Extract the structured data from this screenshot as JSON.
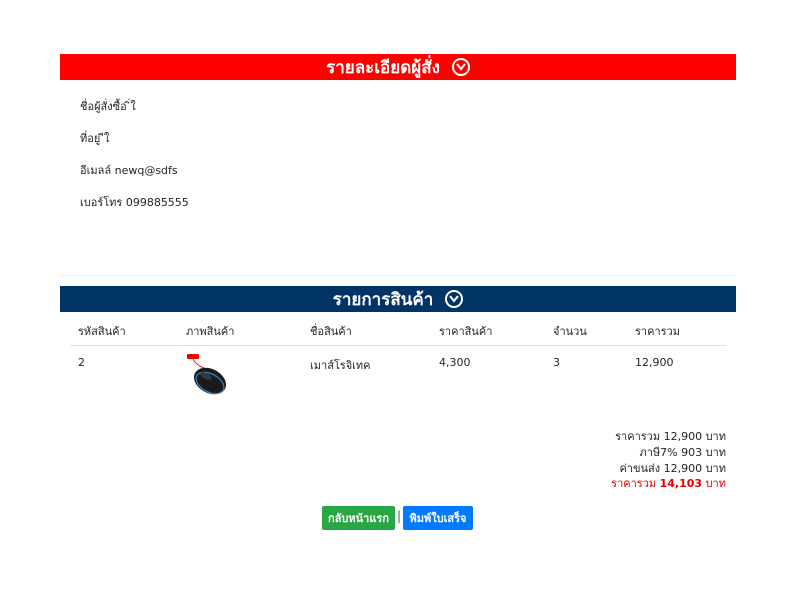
{
  "orderer": {
    "header": "รายละเอียดผู้สั่ง",
    "name_line": "ชื่อผู้สั่งซื้อ ิ่ใ",
    "address_line": "ที่อยู่ ีใ",
    "email_line": "อีเมลล์ newq@sdfs",
    "phone_line": "เบอร์โทร 099885555"
  },
  "products": {
    "header": "รายการสินค้า",
    "columns": [
      "รหัสสินค้า",
      "ภาพสินค้า",
      "ชื่อสินค้า",
      "ราคาสินค้า",
      "จำนวน",
      "ราคารวม"
    ],
    "rows": [
      {
        "code": "2",
        "image": "mouse-image",
        "name": "เมาส์โรจิเทค",
        "price": "4,300",
        "qty": "3",
        "total": "12,900"
      }
    ]
  },
  "summary": {
    "subtotal": "ราคารวม 12,900 บาท",
    "vat": "ภาษี7% 903 บาท",
    "shipping": "ค่าขนส่ง 12,900 บาท",
    "grand_prefix": "ราคารวม ",
    "grand_value": "14,103",
    "grand_suffix": " บาท"
  },
  "actions": {
    "home_label": "กลับหน้าแรก",
    "separator": "|",
    "print_label": "พิมพ์ใบเสร็จ"
  },
  "colors": {
    "orderer_bar": "#ff0000",
    "products_bar": "#003366",
    "home_button": "#28a745",
    "print_button": "#007bff",
    "grand_total": "#e00000"
  }
}
